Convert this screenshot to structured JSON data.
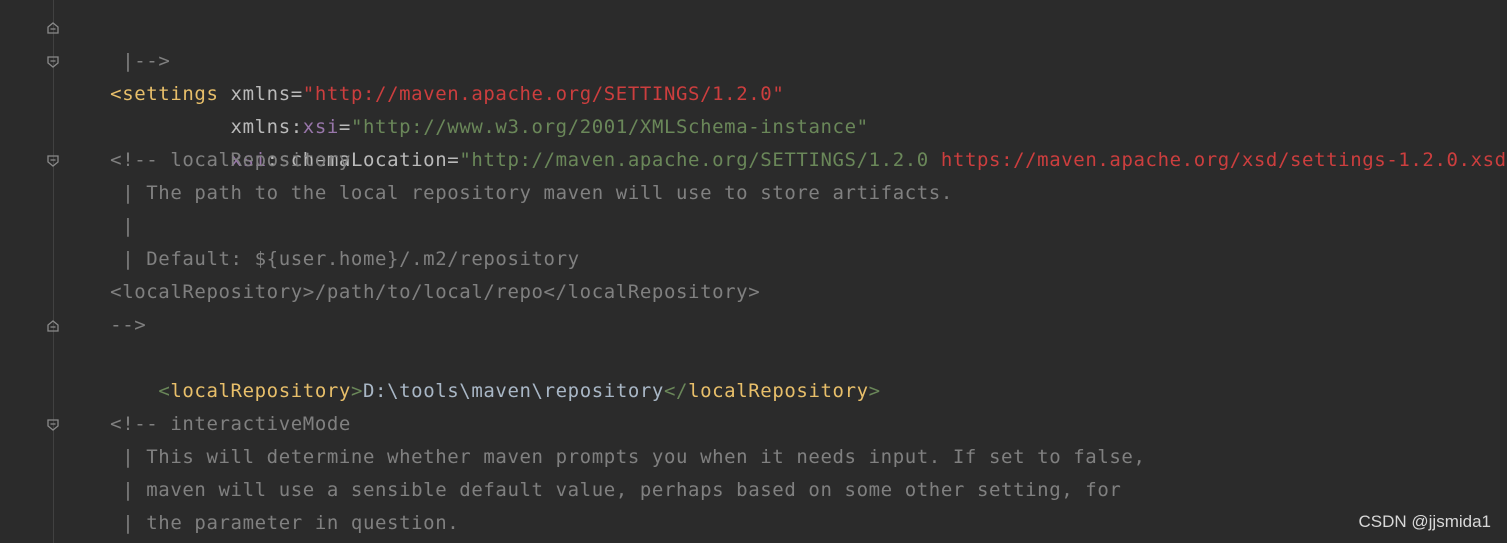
{
  "editor": {
    "lines": [
      {
        "pre": " ",
        "comment": "|-->"
      },
      {
        "tag_open": "<settings",
        "attr1": " xmlns",
        "eq1": "=",
        "val1": "\"http://maven.apache.org/SETTINGS/1.2.0\""
      },
      {
        "indent": "          ",
        "attr": "xmlns",
        "colon": ":",
        "ns": "xsi",
        "eq": "=",
        "val": "\"http://www.w3.org/2001/XMLSchema-instance\""
      },
      {
        "indent": "          ",
        "ns": "xsi",
        "colon": ":",
        "attr": "schemaLocation",
        "eq": "=",
        "val_a": "\"http://maven.apache.org/SETTINGS/1.2.0 ",
        "val_b": "https://maven.apache.org/xsd/settings-1.2.0.xsd",
        "val_c": "\"",
        "close": ">"
      },
      {
        "text": "    <!-- localRepository"
      },
      {
        "text": "     | The path to the local repository maven will use to store artifacts."
      },
      {
        "text": "     |"
      },
      {
        "text": "     | Default: ${user.home}/.m2/repository"
      },
      {
        "text": "    <localRepository>/path/to/local/repo</localRepository>"
      },
      {
        "text": "    -->"
      },
      {
        "indent": "    ",
        "lt": "<",
        "tag": "localRepository",
        "gt": ">",
        "value": "D:\\tools\\maven\\repository",
        "lt2": "</",
        "tag2": "localRepository",
        "gt2": ">"
      },
      {
        "text": ""
      },
      {
        "text": "    <!-- interactiveMode"
      },
      {
        "text": "     | This will determine whether maven prompts you when it needs input. If set to false,"
      },
      {
        "text": "     | maven will use a sensible default value, perhaps based on some other setting, for"
      },
      {
        "text": "     | the parameter in question."
      }
    ]
  },
  "watermark": "CSDN @jjsmida1",
  "colors": {
    "background": "#2b2b2b",
    "comment": "#808080",
    "tag": "#e8bf6a",
    "string": "#6a8759",
    "url": "#cc3e3e",
    "namespace": "#9876aa"
  },
  "icons": [
    "fold-end-icon",
    "fold-start-icon"
  ]
}
